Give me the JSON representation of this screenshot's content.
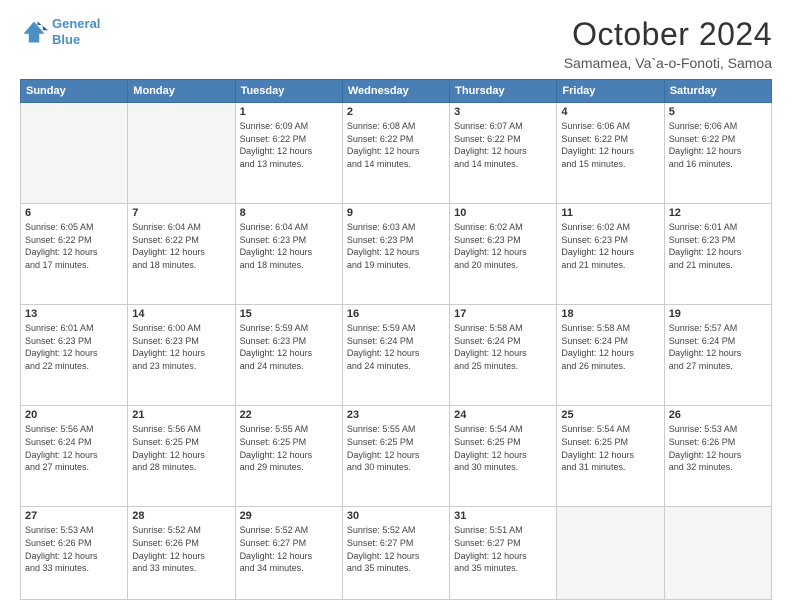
{
  "logo": {
    "line1": "General",
    "line2": "Blue"
  },
  "title": "October 2024",
  "subtitle": "Samamea, Va`a-o-Fonoti, Samoa",
  "days_header": [
    "Sunday",
    "Monday",
    "Tuesday",
    "Wednesday",
    "Thursday",
    "Friday",
    "Saturday"
  ],
  "weeks": [
    [
      {
        "num": "",
        "info": ""
      },
      {
        "num": "",
        "info": ""
      },
      {
        "num": "1",
        "info": "Sunrise: 6:09 AM\nSunset: 6:22 PM\nDaylight: 12 hours\nand 13 minutes."
      },
      {
        "num": "2",
        "info": "Sunrise: 6:08 AM\nSunset: 6:22 PM\nDaylight: 12 hours\nand 14 minutes."
      },
      {
        "num": "3",
        "info": "Sunrise: 6:07 AM\nSunset: 6:22 PM\nDaylight: 12 hours\nand 14 minutes."
      },
      {
        "num": "4",
        "info": "Sunrise: 6:06 AM\nSunset: 6:22 PM\nDaylight: 12 hours\nand 15 minutes."
      },
      {
        "num": "5",
        "info": "Sunrise: 6:06 AM\nSunset: 6:22 PM\nDaylight: 12 hours\nand 16 minutes."
      }
    ],
    [
      {
        "num": "6",
        "info": "Sunrise: 6:05 AM\nSunset: 6:22 PM\nDaylight: 12 hours\nand 17 minutes."
      },
      {
        "num": "7",
        "info": "Sunrise: 6:04 AM\nSunset: 6:22 PM\nDaylight: 12 hours\nand 18 minutes."
      },
      {
        "num": "8",
        "info": "Sunrise: 6:04 AM\nSunset: 6:23 PM\nDaylight: 12 hours\nand 18 minutes."
      },
      {
        "num": "9",
        "info": "Sunrise: 6:03 AM\nSunset: 6:23 PM\nDaylight: 12 hours\nand 19 minutes."
      },
      {
        "num": "10",
        "info": "Sunrise: 6:02 AM\nSunset: 6:23 PM\nDaylight: 12 hours\nand 20 minutes."
      },
      {
        "num": "11",
        "info": "Sunrise: 6:02 AM\nSunset: 6:23 PM\nDaylight: 12 hours\nand 21 minutes."
      },
      {
        "num": "12",
        "info": "Sunrise: 6:01 AM\nSunset: 6:23 PM\nDaylight: 12 hours\nand 21 minutes."
      }
    ],
    [
      {
        "num": "13",
        "info": "Sunrise: 6:01 AM\nSunset: 6:23 PM\nDaylight: 12 hours\nand 22 minutes."
      },
      {
        "num": "14",
        "info": "Sunrise: 6:00 AM\nSunset: 6:23 PM\nDaylight: 12 hours\nand 23 minutes."
      },
      {
        "num": "15",
        "info": "Sunrise: 5:59 AM\nSunset: 6:23 PM\nDaylight: 12 hours\nand 24 minutes."
      },
      {
        "num": "16",
        "info": "Sunrise: 5:59 AM\nSunset: 6:24 PM\nDaylight: 12 hours\nand 24 minutes."
      },
      {
        "num": "17",
        "info": "Sunrise: 5:58 AM\nSunset: 6:24 PM\nDaylight: 12 hours\nand 25 minutes."
      },
      {
        "num": "18",
        "info": "Sunrise: 5:58 AM\nSunset: 6:24 PM\nDaylight: 12 hours\nand 26 minutes."
      },
      {
        "num": "19",
        "info": "Sunrise: 5:57 AM\nSunset: 6:24 PM\nDaylight: 12 hours\nand 27 minutes."
      }
    ],
    [
      {
        "num": "20",
        "info": "Sunrise: 5:56 AM\nSunset: 6:24 PM\nDaylight: 12 hours\nand 27 minutes."
      },
      {
        "num": "21",
        "info": "Sunrise: 5:56 AM\nSunset: 6:25 PM\nDaylight: 12 hours\nand 28 minutes."
      },
      {
        "num": "22",
        "info": "Sunrise: 5:55 AM\nSunset: 6:25 PM\nDaylight: 12 hours\nand 29 minutes."
      },
      {
        "num": "23",
        "info": "Sunrise: 5:55 AM\nSunset: 6:25 PM\nDaylight: 12 hours\nand 30 minutes."
      },
      {
        "num": "24",
        "info": "Sunrise: 5:54 AM\nSunset: 6:25 PM\nDaylight: 12 hours\nand 30 minutes."
      },
      {
        "num": "25",
        "info": "Sunrise: 5:54 AM\nSunset: 6:25 PM\nDaylight: 12 hours\nand 31 minutes."
      },
      {
        "num": "26",
        "info": "Sunrise: 5:53 AM\nSunset: 6:26 PM\nDaylight: 12 hours\nand 32 minutes."
      }
    ],
    [
      {
        "num": "27",
        "info": "Sunrise: 5:53 AM\nSunset: 6:26 PM\nDaylight: 12 hours\nand 33 minutes."
      },
      {
        "num": "28",
        "info": "Sunrise: 5:52 AM\nSunset: 6:26 PM\nDaylight: 12 hours\nand 33 minutes."
      },
      {
        "num": "29",
        "info": "Sunrise: 5:52 AM\nSunset: 6:27 PM\nDaylight: 12 hours\nand 34 minutes."
      },
      {
        "num": "30",
        "info": "Sunrise: 5:52 AM\nSunset: 6:27 PM\nDaylight: 12 hours\nand 35 minutes."
      },
      {
        "num": "31",
        "info": "Sunrise: 5:51 AM\nSunset: 6:27 PM\nDaylight: 12 hours\nand 35 minutes."
      },
      {
        "num": "",
        "info": ""
      },
      {
        "num": "",
        "info": ""
      }
    ]
  ]
}
